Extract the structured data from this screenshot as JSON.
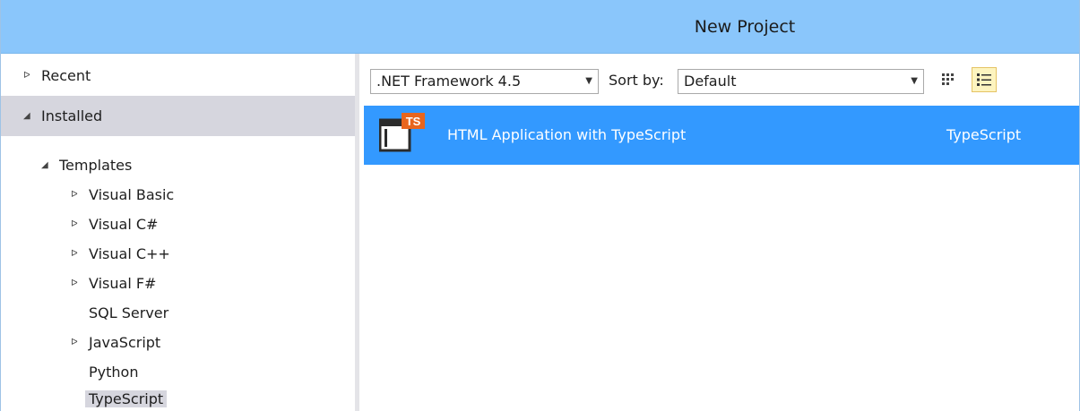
{
  "window": {
    "title": "New Project"
  },
  "sidebar": {
    "recent": "Recent",
    "installed": "Installed",
    "templates": "Templates",
    "items": [
      {
        "label": "Visual Basic",
        "expandable": true
      },
      {
        "label": "Visual C#",
        "expandable": true
      },
      {
        "label": "Visual C++",
        "expandable": true
      },
      {
        "label": "Visual F#",
        "expandable": true
      },
      {
        "label": "SQL Server",
        "expandable": false
      },
      {
        "label": "JavaScript",
        "expandable": true
      },
      {
        "label": "Python",
        "expandable": false
      },
      {
        "label": "TypeScript",
        "expandable": false,
        "selected": true
      }
    ]
  },
  "toolbar": {
    "framework": ".NET Framework 4.5",
    "sort_label": "Sort by:",
    "sort_value": "Default"
  },
  "templates": [
    {
      "name": "HTML Application with TypeScript",
      "language": "TypeScript",
      "icon_badge": "TS",
      "selected": true
    }
  ],
  "colors": {
    "titlebar": "#8ac6fb",
    "selection": "#3399ff",
    "sidebar_selection": "#d6d6de",
    "ts_badge": "#e8651d"
  }
}
